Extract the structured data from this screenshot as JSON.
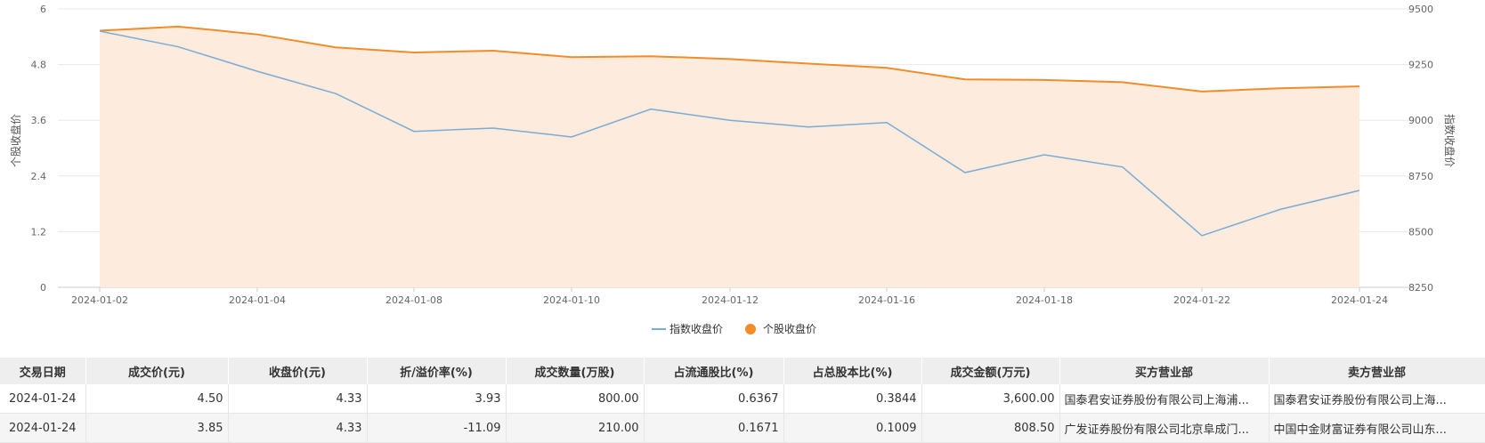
{
  "chart_data": {
    "type": "line",
    "x": [
      "2024-01-02",
      "2024-01-03",
      "2024-01-04",
      "2024-01-05",
      "2024-01-08",
      "2024-01-09",
      "2024-01-10",
      "2024-01-11",
      "2024-01-12",
      "2024-01-15",
      "2024-01-16",
      "2024-01-17",
      "2024-01-18",
      "2024-01-19",
      "2024-01-22",
      "2024-01-23",
      "2024-01-24"
    ],
    "x_tick_labels": [
      "2024-01-02",
      "2024-01-04",
      "2024-01-08",
      "2024-01-10",
      "2024-01-12",
      "2024-01-16",
      "2024-01-18",
      "2024-01-22",
      "2024-01-24"
    ],
    "y_left": {
      "label": "个股收盘价",
      "ticks": [
        "0",
        "1.2",
        "2.4",
        "3.6",
        "4.8",
        "6"
      ],
      "range": [
        0,
        6
      ]
    },
    "y_right": {
      "label": "指数收盘价",
      "ticks": [
        "8250",
        "8500",
        "8750",
        "9000",
        "9250",
        "9500"
      ],
      "range": [
        8250,
        9500
      ]
    },
    "series": [
      {
        "name": "指数收盘价",
        "axis": "right",
        "color": "#7aacd6",
        "style": "line",
        "values": [
          9400,
          9330,
          9220,
          9120,
          8950,
          8965,
          8925,
          9050,
          9000,
          8970,
          8990,
          8765,
          8845,
          8790,
          8482,
          8600,
          8685
        ]
      },
      {
        "name": "个股收盘价",
        "axis": "left",
        "color": "#f28c28",
        "style": "area",
        "fill": "#fdebdd",
        "values": [
          5.53,
          5.62,
          5.45,
          5.17,
          5.06,
          5.1,
          4.96,
          4.98,
          4.92,
          4.82,
          4.73,
          4.48,
          4.47,
          4.42,
          4.22,
          4.29,
          4.33
        ]
      }
    ],
    "legend": "bottom-center",
    "grid": true
  },
  "table": {
    "headers": [
      "交易日期",
      "成交价(元)",
      "收盘价(元)",
      "折/溢价率(%)",
      "成交数量(万股)",
      "占流通股比(%)",
      "占总股本比(%)",
      "成交金额(万元)",
      "买方营业部",
      "卖方营业部"
    ],
    "rows": [
      [
        "2024-01-24",
        "4.50",
        "4.33",
        "3.93",
        "800.00",
        "0.6367",
        "0.3844",
        "3,600.00",
        "国泰君安证券股份有限公司上海浦...",
        "国泰君安证券股份有限公司上海..."
      ],
      [
        "2024-01-24",
        "3.85",
        "4.33",
        "-11.09",
        "210.00",
        "0.1671",
        "0.1009",
        "808.50",
        "广发证券股份有限公司北京阜成门...",
        "中国中金财富证券有限公司山东..."
      ]
    ]
  }
}
